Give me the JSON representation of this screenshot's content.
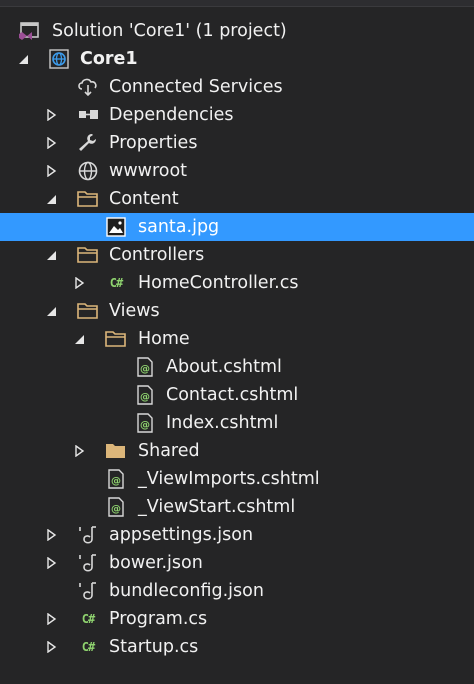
{
  "solution_explorer": {
    "rows": [
      {
        "label": "Solution 'Core1' (1 project)",
        "icon": "visual-studio-solution-icon",
        "expander": "none",
        "bold": false
      },
      {
        "label": "Core1",
        "icon": "web-project-globe-icon",
        "expander": "expanded",
        "bold": true
      },
      {
        "label": "Connected Services",
        "icon": "connected-services-cloud-icon",
        "expander": "none",
        "bold": false
      },
      {
        "label": "Dependencies",
        "icon": "dependencies-icon",
        "expander": "collapsed",
        "bold": false
      },
      {
        "label": "Properties",
        "icon": "wrench-icon",
        "expander": "collapsed",
        "bold": false
      },
      {
        "label": "wwwroot",
        "icon": "globe-icon",
        "expander": "collapsed",
        "bold": false
      },
      {
        "label": "Content",
        "icon": "folder-open-icon",
        "expander": "expanded",
        "bold": false
      },
      {
        "label": "santa.jpg",
        "icon": "image-file-icon",
        "expander": "none",
        "bold": false,
        "selected": true
      },
      {
        "label": "Controllers",
        "icon": "folder-open-icon",
        "expander": "expanded",
        "bold": false
      },
      {
        "label": "HomeController.cs",
        "icon": "csharp-file-icon",
        "expander": "collapsed",
        "bold": false
      },
      {
        "label": "Views",
        "icon": "folder-open-icon",
        "expander": "expanded",
        "bold": false
      },
      {
        "label": "Home",
        "icon": "folder-open-icon",
        "expander": "expanded",
        "bold": false
      },
      {
        "label": "About.cshtml",
        "icon": "razor-file-icon",
        "expander": "none",
        "bold": false
      },
      {
        "label": "Contact.cshtml",
        "icon": "razor-file-icon",
        "expander": "none",
        "bold": false
      },
      {
        "label": "Index.cshtml",
        "icon": "razor-file-icon",
        "expander": "none",
        "bold": false
      },
      {
        "label": "Shared",
        "icon": "folder-closed-icon",
        "expander": "collapsed",
        "bold": false
      },
      {
        "label": "_ViewImports.cshtml",
        "icon": "razor-file-icon",
        "expander": "none",
        "bold": false
      },
      {
        "label": "_ViewStart.cshtml",
        "icon": "razor-file-icon",
        "expander": "none",
        "bold": false
      },
      {
        "label": "appsettings.json",
        "icon": "json-file-icon",
        "expander": "collapsed",
        "bold": false
      },
      {
        "label": "bower.json",
        "icon": "json-file-icon",
        "expander": "collapsed",
        "bold": false
      },
      {
        "label": "bundleconfig.json",
        "icon": "json-file-icon",
        "expander": "none",
        "bold": false
      },
      {
        "label": "Program.cs",
        "icon": "csharp-file-icon",
        "expander": "collapsed",
        "bold": false
      },
      {
        "label": "Startup.cs",
        "icon": "csharp-file-icon",
        "expander": "collapsed",
        "bold": false
      }
    ]
  },
  "colors": {
    "background": "#252526",
    "selection": "#3399ff",
    "text": "#f1f1f1",
    "folder": "#dcb67a",
    "csharp": "#8fd36f",
    "vs_purple": "#9b4f96"
  }
}
